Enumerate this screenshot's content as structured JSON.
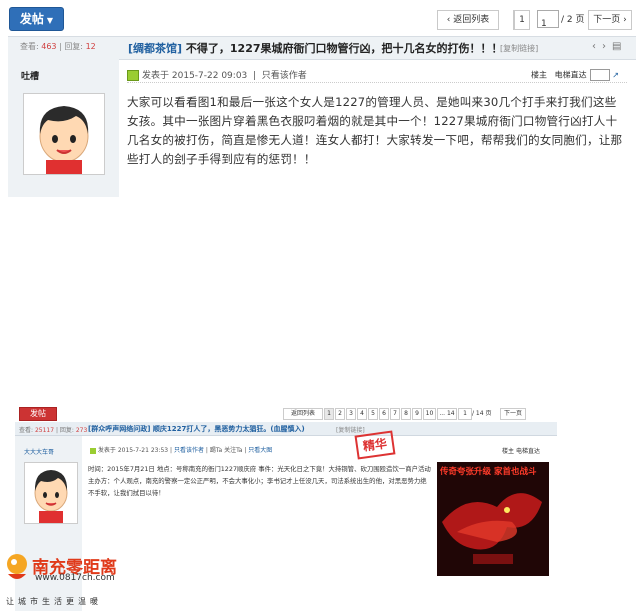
{
  "top": {
    "reply_button": "发帖",
    "pagination": {
      "back_label": "返回列表",
      "pages": [
        "1",
        "2"
      ],
      "current_input": "1",
      "total": "/ 2 页",
      "next_label": "下一页"
    },
    "header": {
      "views_label": "查看:",
      "views": "463",
      "replies_label": "回复:",
      "replies": "12",
      "title_tag": "[绸都茶馆]",
      "title": "不得了，1227果城府衙门口物管行凶，把十几名女的打伤！！！",
      "copy_link": "[复制链接]"
    },
    "author": {
      "name": "吐槽"
    },
    "post": {
      "posted_label": "发表于",
      "posted_time": "2015-7-22 09:03",
      "only_author": "只看该作者",
      "floor_label": "楼主",
      "jump_label": "电梯直达",
      "paragraph": "大家可以看看图1和最后一张这个女人是1227的管理人员、是她叫来30几个打手来打我们这些女孩。其中一张图片穿着黑色衣服叼着烟的就是其中一个！1227果城府衙门口物管行凶打人十几名女的被打伤，简直是惨无人道！连女人都打！大家转发一下吧，帮帮我们的女同胞们，让那些打人的刽子手得到应有的惩罚！！"
    }
  },
  "bottom": {
    "reply_button": "发帖",
    "pagination": {
      "back_label": "返回列表",
      "pages": [
        "1",
        "2",
        "3",
        "4",
        "5",
        "6",
        "7",
        "8",
        "9",
        "10"
      ],
      "ellipsis": "... 14",
      "current_input": "1",
      "total": "/ 14 页",
      "next_label": "下一页"
    },
    "header": {
      "views_label": "查看:",
      "views": "25117",
      "replies_label": "回复:",
      "replies": "273",
      "title": "[群众呼声网络问政] 顺庆1227打人了，黑恶势力太猖狂。(血腥慎入)",
      "copy_link": "[复制链接]"
    },
    "author": {
      "name": "大大大车哥"
    },
    "post": {
      "posted_label": "发表于",
      "posted_time": "2015-7-21 23:53",
      "only_author": "只看该作者",
      "extra1": "踢Ta",
      "extra2": "关注Ta",
      "extra3": "只看大图",
      "floor_label": "楼主",
      "jump_label": "电梯直达",
      "stamp": "精华",
      "paragraph": "时间：2015年7月21日  地点：号称南充的衙门1227顺庆府  事件：光天化日之下竟！大持铜管、砍刀围殴造饮一商户活动主办方：个人观点，南充的警察一定公正严明，不会大事化小；李书记才上任没几天，司法系统出生的他，对黑恶势力绝不手软，让我们拭目以待！",
      "ad_title": "传奇夸张升级  家首也战斗"
    }
  },
  "watermark": {
    "logo_text": "南充零距离",
    "site": "www.0817ch.com",
    "slogan": "让城市生活更温暖"
  }
}
